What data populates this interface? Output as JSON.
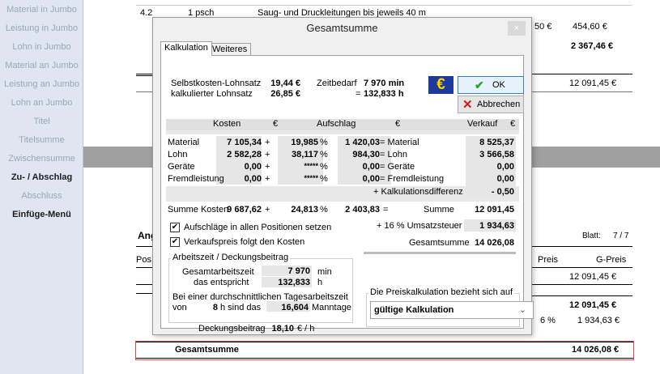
{
  "sidebar": {
    "items": [
      {
        "label": "Material in Jumbo"
      },
      {
        "label": "Leistung in Jumbo"
      },
      {
        "label": "Lohn in Jumbo"
      },
      {
        "label": "Material an Jumbo"
      },
      {
        "label": "Leistung an Jumbo"
      },
      {
        "label": "Lohn an Jumbo"
      },
      {
        "label": "Titel"
      },
      {
        "label": "Titelsumme"
      },
      {
        "label": "Zwischensumme"
      },
      {
        "label": "Zu- / Abschlag"
      },
      {
        "label": "Abschluss"
      },
      {
        "label": "Einfüge-Menü"
      }
    ]
  },
  "document": {
    "pos_no": "4.2",
    "qty": "1 psch",
    "description": "Saug- und Druckleitungen bis jeweils  40 m",
    "row_ep_partial": "50 €",
    "row_price": "454,60 €",
    "subtotal1": "2 367,46 €",
    "subtotal2": "12 091,45 €",
    "section_partial": "Ang",
    "blatt_label": "Blatt:",
    "blatt_value": "7 / 7",
    "col_pos_partial": "Pos",
    "col_preis_partial": "Preis",
    "col_gpreis": "G-Preis",
    "gpreis_1": "12 091,45 €",
    "net_total": "12 091,45 €",
    "vat_partial": "6 %",
    "vat_amount": "1 934,63 €",
    "gesamtsumme_label": "Gesamtsumme",
    "gesamtsumme_value": "14 026,08 €"
  },
  "dialog": {
    "title": "Gesamtsumme",
    "close_glyph": "×",
    "tabs": [
      "Kalkulation",
      "Weiteres"
    ],
    "selbstkosten_label": "Selbstkosten-Lohnsatz",
    "selbstkosten_value": "19,44 €",
    "kalk_lohnsatz_label": "kalkulierter Lohnsatz",
    "kalk_lohnsatz_value": "26,85 €",
    "zeitbedarf_label": "Zeitbedarf",
    "zeitbedarf_min": "7 970  min",
    "zeitbedarf_eq": "=",
    "zeitbedarf_h": "132,833  h",
    "euro_symbol": "€",
    "ok_label": "OK",
    "cancel_label": "Abbrechen",
    "table": {
      "headers": [
        "Kosten",
        "€",
        "Aufschlag",
        "€",
        "Verkauf",
        "€"
      ],
      "rows": [
        {
          "label": "Material",
          "kosten": "7 105,34",
          "op": "+",
          "aufschlag": "19,985",
          "pct": "%",
          "aufschlag_eur": "1 420,03",
          "eq": "= Material",
          "verkauf": "8 525,37"
        },
        {
          "label": "Lohn",
          "kosten": "2 582,28",
          "op": "+",
          "aufschlag": "38,117",
          "pct": "%",
          "aufschlag_eur": "984,30",
          "eq": "= Lohn",
          "verkauf": "3 566,58"
        },
        {
          "label": "Geräte",
          "kosten": "0,00",
          "op": "+",
          "aufschlag": "*****",
          "pct": "%",
          "aufschlag_eur": "0,00",
          "eq": "= Geräte",
          "verkauf": "0,00"
        },
        {
          "label": "Fremdleistung",
          "kosten": "0,00",
          "op": "+",
          "aufschlag": "*****",
          "pct": "%",
          "aufschlag_eur": "0,00",
          "eq": "= Fremdleistung",
          "verkauf": "0,00"
        }
      ],
      "kalk_diff_label": "+ Kalkulationsdifferenz",
      "kalk_diff_value": "- 0,50"
    },
    "summe_kosten_label": "Summe Kosten",
    "summe_kosten_value": "9 687,62",
    "summe_op": "+",
    "summe_aufschlag": "24,813",
    "summe_pct": "%",
    "summe_aufschlag_eur": "2 403,83",
    "summe_eq": "=",
    "summe_label": "Summe",
    "summe_value": "12 091,45",
    "ust_label": "+ 16 % Umsatzsteuer",
    "ust_value": "1 934,63",
    "gesamt_label": "Gesamtsumme",
    "gesamt_value": "14 026,08",
    "check1": "Aufschläge in allen Positionen setzen",
    "check2": "Verkaufspreis folgt den Kosten",
    "check_glyph": "✔",
    "group_title": "Arbeitszeit / Deckungsbeitrag",
    "gesamtarbeitszeit_label": "Gesamtarbeitszeit",
    "gesamtarbeitszeit_value": "7 970",
    "gesamtarbeitszeit_unit": "min",
    "das_entspricht_label": "das entspricht",
    "das_entspricht_value": "132,833",
    "das_entspricht_unit": "h",
    "tagesarbeitszeit_text": "Bei einer durchschnittlichen Tagesarbeitszeit",
    "von_label": "von",
    "von_value": "8",
    "sind_das_label": "h  sind das",
    "manntage_value": "16,604",
    "manntage_label": "Manntage",
    "deckungsbeitrag_label": "Deckungsbeitrag",
    "deckungsbeitrag_value": "18,10",
    "deckungsbeitrag_unit": "€ / h",
    "preiskalk_label": "Die Preiskalkulation bezieht sich auf",
    "preiskalk_value": "gültige Kalkulation"
  },
  "colors": {
    "sidebar_bg": "#dfe6f1",
    "ok_green": "#2e9e2e",
    "cancel_red": "#d01b1b",
    "euro_blue": "#1b3a9a",
    "euro_yellow": "#ffd200",
    "total_border": "#d24a4a"
  }
}
